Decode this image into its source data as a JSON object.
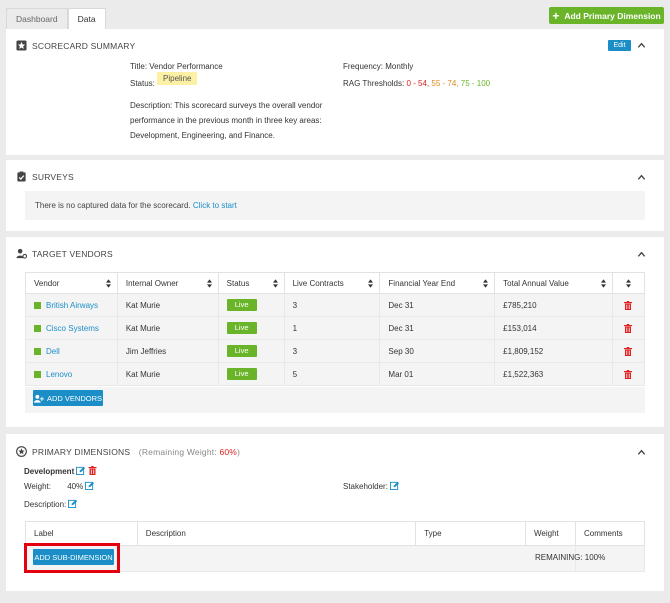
{
  "tabs": [
    {
      "label": "Dashboard"
    },
    {
      "label": "Data"
    }
  ],
  "add_primary_button": "Add Primary Dimension",
  "scorecard": {
    "heading": "SCORECARD SUMMARY",
    "edit_label": "Edit",
    "title_label": "Title:",
    "title_value": "Vendor Performance",
    "status_label": "Status:",
    "status_value": "Pipeline",
    "description_label": "Description:",
    "description_line1": "This scorecard surveys the overall vendor",
    "description_line2": "performance in the previous month in three key areas:",
    "description_line3": "Development, Engineering, and Finance.",
    "frequency_label": "Frequency:",
    "frequency_value": "Monthly",
    "rag_label": "RAG Thresholds:",
    "rag_red": "0 - 54,",
    "rag_orange": "55 - 74,",
    "rag_green": "75 - 100",
    "colors": {
      "red": "#e02020",
      "orange": "#e08a20",
      "green": "#6ab42a"
    }
  },
  "surveys": {
    "heading": "SURVEYS",
    "empty_text": "There is no captured data for the scorecard.",
    "start_link": "Click to start"
  },
  "vendors": {
    "heading": "TARGET VENDORS",
    "columns": [
      "Vendor",
      "Internal Owner",
      "Status",
      "Live Contracts",
      "Financial Year End",
      "Total Annual Value"
    ],
    "rows": [
      {
        "vendor": "British Airways",
        "owner": "Kat Murie",
        "status": "Live",
        "contracts": "3",
        "fye": "Dec 31",
        "value": "£785,210"
      },
      {
        "vendor": "Cisco Systems",
        "owner": "Kat Murie",
        "status": "Live",
        "contracts": "1",
        "fye": "Dec 31",
        "value": "£153,014"
      },
      {
        "vendor": "Dell",
        "owner": "Jim Jeffries",
        "status": "Live",
        "contracts": "3",
        "fye": "Sep 30",
        "value": "£1,809,152"
      },
      {
        "vendor": "Lenovo",
        "owner": "Kat Murie",
        "status": "Live",
        "contracts": "5",
        "fye": "Mar 01",
        "value": "£1,522,363"
      }
    ],
    "add_button": "ADD VENDORS"
  },
  "primary": {
    "heading": "PRIMARY DIMENSIONS",
    "remaining_prefix": "(Remaining Weight:",
    "remaining_value": "60%",
    "remaining_suffix": ")",
    "dimension_name": "Development",
    "weight_label": "Weight:",
    "weight_value": "40%",
    "stakeholder_label": "Stakeholder:",
    "description_label": "Description:",
    "columns": [
      "Label",
      "Description",
      "Type",
      "Weight",
      "Comments"
    ],
    "add_sub_button": "ADD SUB-DIMENSION",
    "remaining_row": "REMAINING: 100%"
  }
}
